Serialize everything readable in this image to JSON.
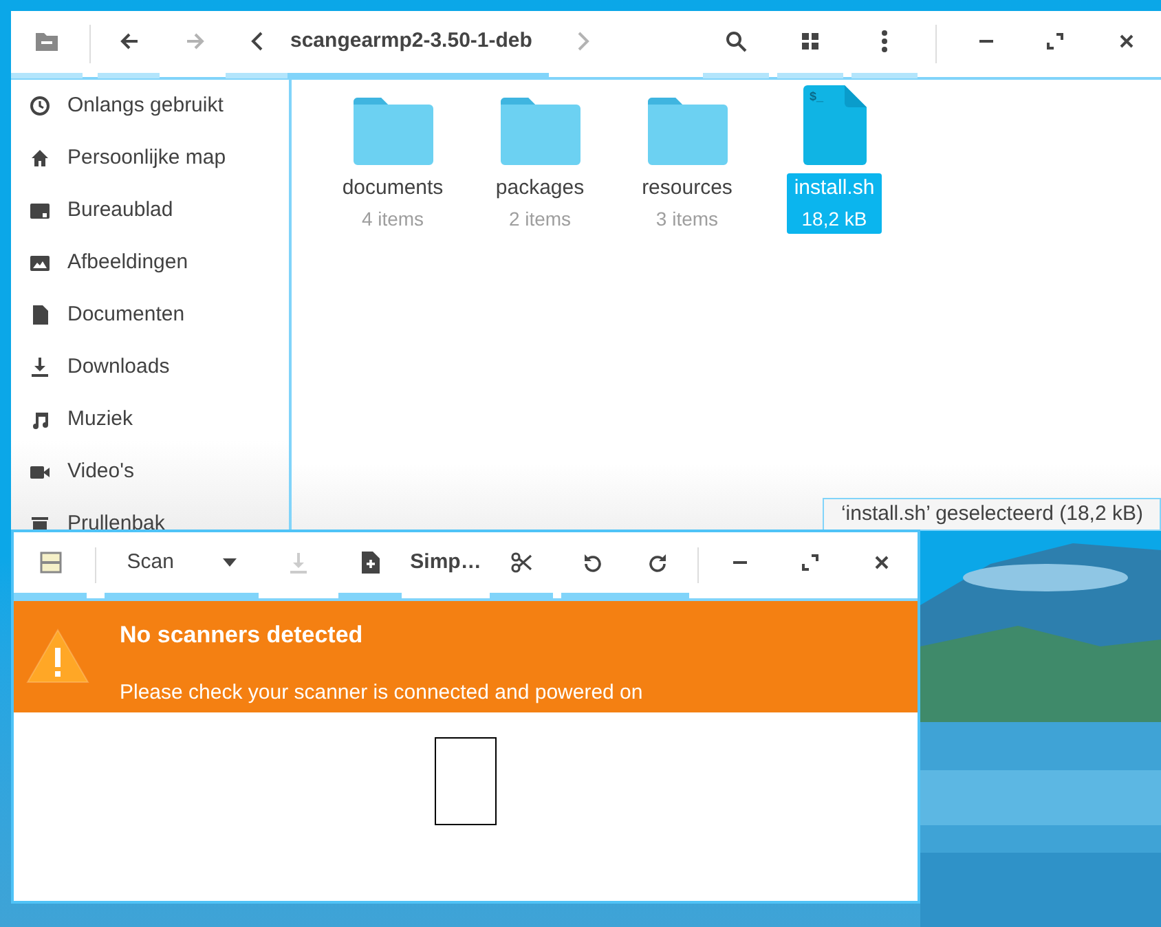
{
  "file_manager": {
    "back_disabled": false,
    "forward_disabled": true,
    "path": "scangearmp2-3.50-1-deb",
    "next_disabled": true,
    "sidebar": [
      {
        "kind": "recent",
        "label": "Onlangs gebruikt"
      },
      {
        "kind": "home",
        "label": "Persoonlijke map"
      },
      {
        "kind": "desktop",
        "label": "Bureaublad"
      },
      {
        "kind": "pictures",
        "label": "Afbeeldingen"
      },
      {
        "kind": "documents",
        "label": "Documenten"
      },
      {
        "kind": "downloads",
        "label": "Downloads"
      },
      {
        "kind": "music",
        "label": "Muziek"
      },
      {
        "kind": "videos",
        "label": "Video's"
      },
      {
        "kind": "trash",
        "label": "Prullenbak"
      }
    ],
    "files": [
      {
        "kind": "folder",
        "name": "documents",
        "info": "4 items",
        "selected": false
      },
      {
        "kind": "folder",
        "name": "packages",
        "info": "2 items",
        "selected": false
      },
      {
        "kind": "folder",
        "name": "resources",
        "info": "3 items",
        "selected": false
      },
      {
        "kind": "script",
        "icon_text": "$_",
        "name": "install.sh",
        "info": "18,2 kB",
        "selected": true
      }
    ],
    "status": "‘install.sh’ geselecteerd (18,2 kB)"
  },
  "scan_window": {
    "scan_label": "Scan",
    "save_disabled": true,
    "document_type": "Simp…",
    "banner": {
      "title": "No scanners detected",
      "message": "Please check your scanner is connected and powered on"
    }
  }
}
